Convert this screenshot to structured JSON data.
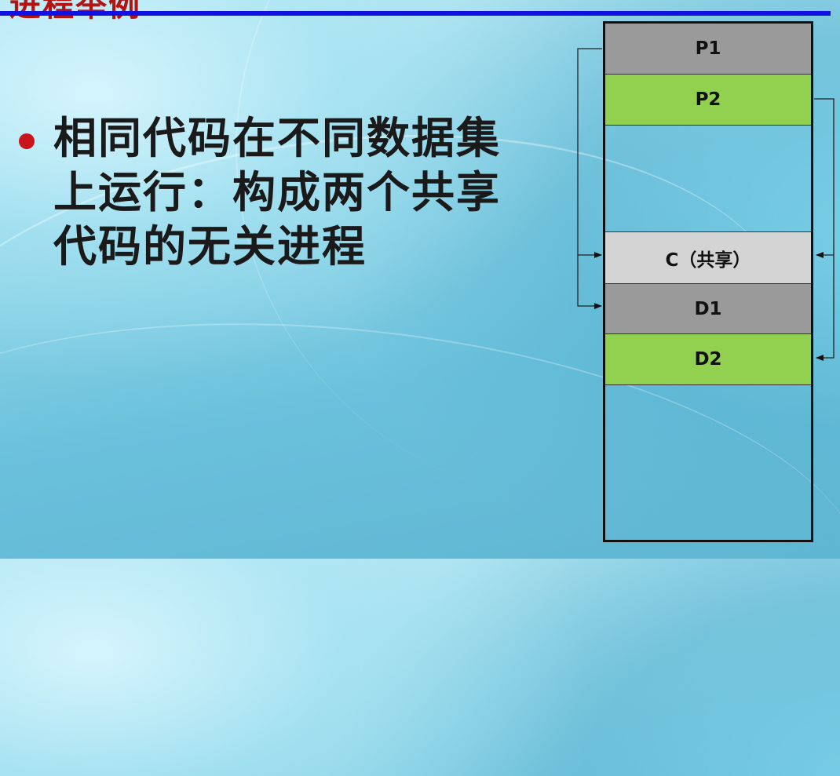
{
  "slide": {
    "title_fragment": "进程举例",
    "bullet_text": "相同代码在不同数据集上运行：构成两个共享代码的无关进程"
  },
  "colors": {
    "title_red": "#b31313",
    "rule_blue": "#1010e0",
    "bullet_red": "#c8141a",
    "segment_dark_gray": "#9a9a9a",
    "segment_green": "#92d050",
    "segment_light_gray": "#d4d4d4",
    "outline": "#111111"
  },
  "memory": {
    "segments": [
      {
        "label": "P1",
        "color": "#9a9a9a"
      },
      {
        "label": "P2",
        "color": "#92d050"
      },
      {
        "label": "",
        "color": "transparent"
      },
      {
        "label": "C（共享）",
        "color": "#d4d4d4"
      },
      {
        "label": "D1",
        "color": "#9a9a9a"
      },
      {
        "label": "D2",
        "color": "#92d050"
      },
      {
        "label": "",
        "color": "transparent"
      }
    ]
  }
}
